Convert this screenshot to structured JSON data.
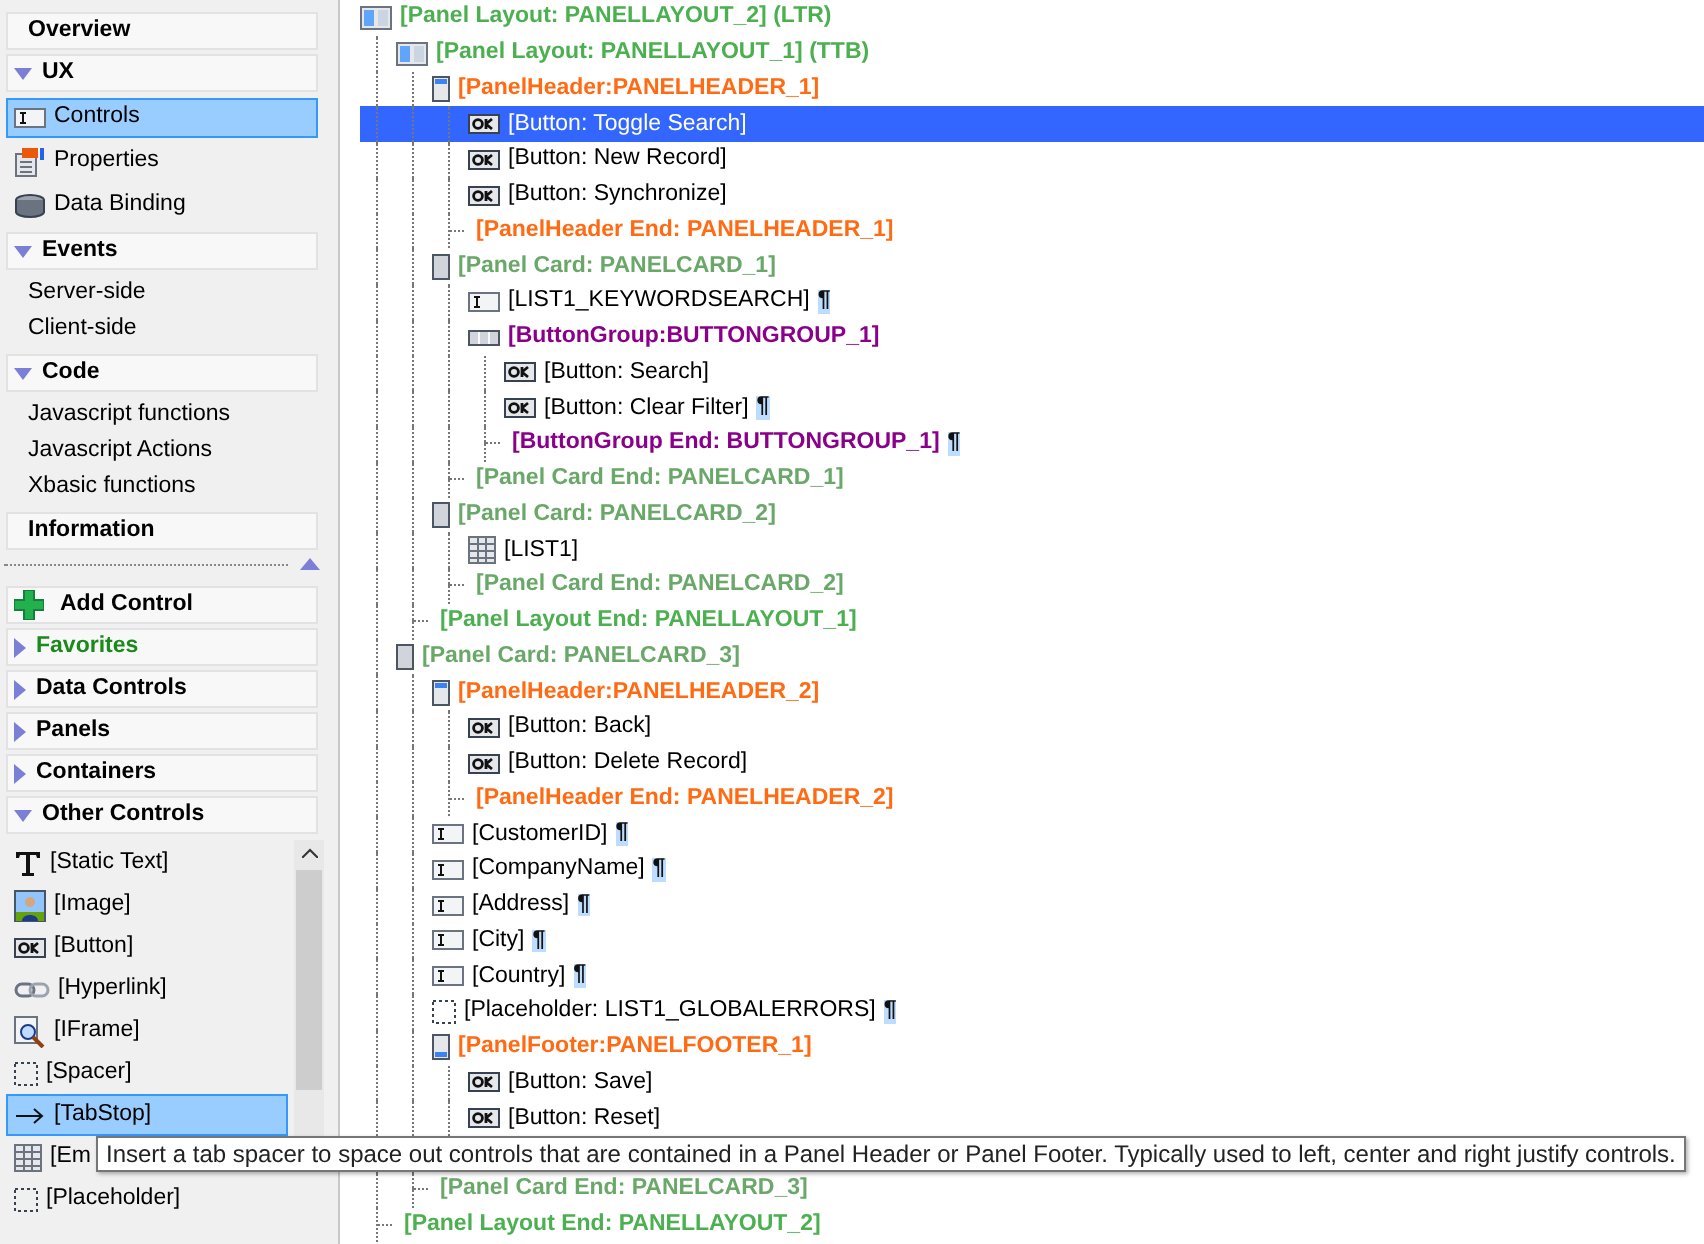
{
  "sidebar": {
    "sections": [
      {
        "title": "Overview",
        "kind": "plain"
      },
      {
        "title": "UX",
        "kind": "group",
        "expanded": true,
        "items": [
          {
            "label": "Controls",
            "kind": "field",
            "selected": true
          },
          {
            "label": "Properties",
            "kind": "properties",
            "selected": false
          },
          {
            "label": "Data Binding",
            "kind": "database",
            "selected": false
          }
        ]
      },
      {
        "title": "Events",
        "kind": "group",
        "expanded": true,
        "items": [
          {
            "label": "Server-side",
            "selected": false
          },
          {
            "label": "Client-side",
            "selected": false
          }
        ]
      },
      {
        "title": "Code",
        "kind": "group",
        "expanded": true,
        "items": [
          {
            "label": "Javascript functions",
            "selected": false
          },
          {
            "label": "Javascript Actions",
            "selected": false
          },
          {
            "label": "Xbasic functions",
            "selected": false
          }
        ]
      },
      {
        "title": "Information",
        "kind": "plain"
      }
    ]
  },
  "toolbox": {
    "sections": [
      {
        "title": "Add Control",
        "kind": "add"
      },
      {
        "title": "Favorites",
        "kind": "favorites",
        "expanded": false
      },
      {
        "title": "Data Controls",
        "kind": "group",
        "expanded": false
      },
      {
        "title": "Panels",
        "kind": "group",
        "expanded": false
      },
      {
        "title": "Containers",
        "kind": "group",
        "expanded": false
      },
      {
        "title": "Other Controls",
        "kind": "group",
        "expanded": true
      }
    ],
    "items": [
      {
        "label": "[Static Text]",
        "kind": "text",
        "selected": false
      },
      {
        "label": "[Image]",
        "kind": "image",
        "selected": false
      },
      {
        "label": "[Button]",
        "kind": "button",
        "selected": false
      },
      {
        "label": "[Hyperlink]",
        "kind": "link",
        "selected": false
      },
      {
        "label": "[IFrame]",
        "kind": "iframe",
        "selected": false
      },
      {
        "label": "[Spacer]",
        "kind": "spacer",
        "selected": false
      },
      {
        "label": "[TabStop]",
        "kind": "arrow",
        "selected": true
      },
      {
        "label": "[Em",
        "kind": "grid",
        "selected": false
      },
      {
        "label": "[Placeholder]",
        "kind": "spacer",
        "selected": false
      }
    ]
  },
  "tree": [
    {
      "kind": "layout",
      "label": "[Panel Layout: PANELLAYOUT_2] (LTR)",
      "children": [
        {
          "kind": "layout",
          "label": "[Panel Layout: PANELLAYOUT_1] (TTB)",
          "children": [
            {
              "kind": "header",
              "label": "[PanelHeader:PANELHEADER_1]",
              "children": [
                {
                  "kind": "button",
                  "label": "[Button: Toggle Search]",
                  "selected": true
                },
                {
                  "kind": "button",
                  "label": "[Button: New Record]",
                  "selected": false
                },
                {
                  "kind": "button",
                  "label": "[Button: Synchronize]",
                  "selected": false
                },
                {
                  "kind": "header_end",
                  "label": "[PanelHeader End: PANELHEADER_1]"
                }
              ]
            },
            {
              "kind": "card",
              "label": "[Panel Card: PANELCARD_1]",
              "children": [
                {
                  "kind": "field",
                  "label": "[LIST1_KEYWORDSEARCH]",
                  "mark": "¶"
                },
                {
                  "kind": "group",
                  "label": "[ButtonGroup:BUTTONGROUP_1]",
                  "children": [
                    {
                      "kind": "button",
                      "label": "[Button: Search]",
                      "selected": false
                    },
                    {
                      "kind": "button",
                      "label": "[Button: Clear Filter]",
                      "mark": "¶",
                      "selected": false
                    },
                    {
                      "kind": "group_end",
                      "label": "[ButtonGroup End: BUTTONGROUP_1]",
                      "mark": "¶"
                    }
                  ]
                },
                {
                  "kind": "card_end",
                  "label": "[Panel Card End: PANELCARD_1]"
                }
              ]
            },
            {
              "kind": "card",
              "label": "[Panel Card: PANELCARD_2]",
              "children": [
                {
                  "kind": "list",
                  "label": "[LIST1]"
                },
                {
                  "kind": "card_end",
                  "label": "[Panel Card End: PANELCARD_2]"
                }
              ]
            },
            {
              "kind": "layout_end",
              "label": "[Panel Layout End: PANELLAYOUT_1]"
            }
          ]
        },
        {
          "kind": "card",
          "label": "[Panel Card: PANELCARD_3]",
          "children": [
            {
              "kind": "header",
              "label": "[PanelHeader:PANELHEADER_2]",
              "children": [
                {
                  "kind": "button",
                  "label": "[Button: Back]",
                  "selected": false
                },
                {
                  "kind": "button",
                  "label": "[Button: Delete Record]",
                  "selected": false
                },
                {
                  "kind": "header_end",
                  "label": "[PanelHeader End: PANELHEADER_2]"
                }
              ]
            },
            {
              "kind": "field",
              "label": "[CustomerID]",
              "mark": "¶"
            },
            {
              "kind": "field",
              "label": "[CompanyName]",
              "mark": "¶"
            },
            {
              "kind": "field",
              "label": "[Address]",
              "mark": "¶"
            },
            {
              "kind": "field",
              "label": "[City]",
              "mark": "¶"
            },
            {
              "kind": "field",
              "label": "[Country]",
              "mark": "¶"
            },
            {
              "kind": "placeholder",
              "label": "[Placeholder: LIST1_GLOBALERRORS]",
              "mark": "¶"
            },
            {
              "kind": "footer",
              "label": "[PanelFooter:PANELFOOTER_1]",
              "children": [
                {
                  "kind": "button",
                  "label": "[Button: Save]",
                  "selected": false
                },
                {
                  "kind": "button",
                  "label": "[Button: Reset]",
                  "selected": false
                }
              ]
            },
            {
              "kind": "card_end",
              "label": "[Panel Card End: PANELCARD_3]"
            }
          ]
        },
        {
          "kind": "layout_end",
          "label": "[Panel Layout End: PANELLAYOUT_2]"
        }
      ]
    }
  ],
  "tooltip": "Insert a tab spacer to space out controls that are contained in a Panel Header or Panel Footer. Typically used to left, center and right justify controls."
}
